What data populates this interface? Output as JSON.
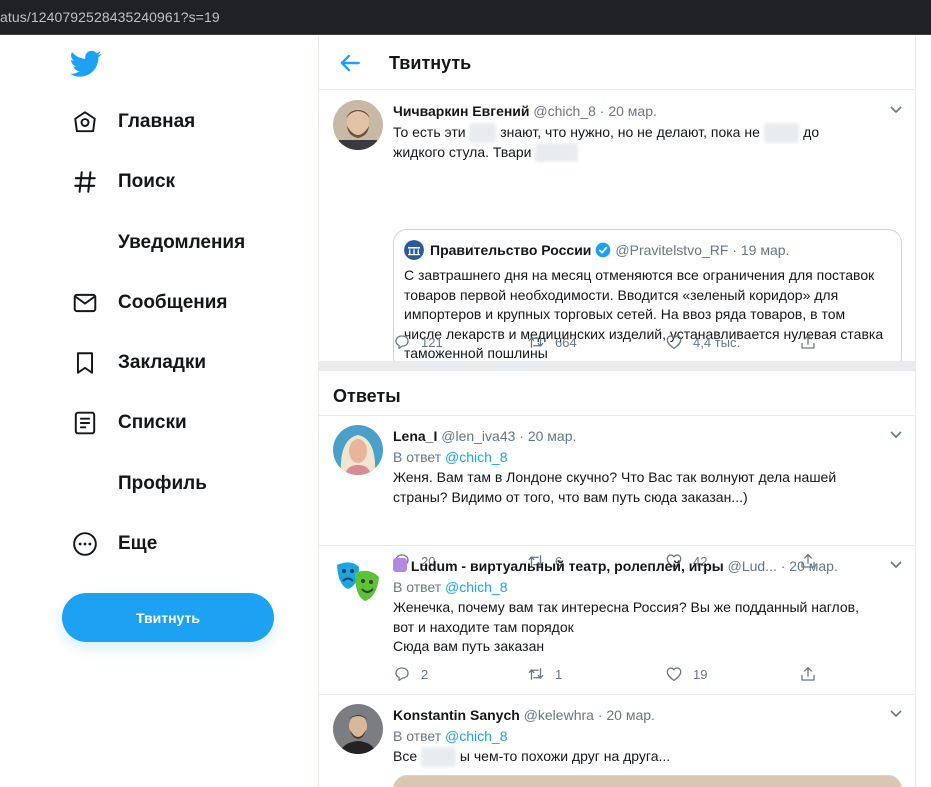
{
  "browser": {
    "url": "atus/1240792528435240961?s=19"
  },
  "sidebar": {
    "items": [
      {
        "label": "Главная"
      },
      {
        "label": "Поиск"
      },
      {
        "label": "Уведомления"
      },
      {
        "label": "Сообщения"
      },
      {
        "label": "Закладки"
      },
      {
        "label": "Списки"
      },
      {
        "label": "Профиль"
      },
      {
        "label": "Еще"
      }
    ],
    "tweet_button": "Твитнуть"
  },
  "header": {
    "title": "Твитнуть"
  },
  "main_tweet": {
    "name": "Чичваркин Евгений",
    "handle": "@chich_8",
    "date": "· 20 мар.",
    "text_a": "То есть эти",
    "text_b": "знают, что нужно, но не делают, пока не",
    "text_c": "до",
    "text_d": "жидкого стула. Твари",
    "quote": {
      "name": "Правительство России",
      "handle": "@Pravitelstvo_RF",
      "date": "· 19 мар.",
      "text": "С завтрашнего дня на месяц отменяются все ограничения для поставок товаров первой необходимости. Вводится «зеленый коридор» для импортеров и крупных торговых сетей. На ввоз ряда товаров, в том числе лекарств и медицинских изделий, устанавливается нулевая ставка таможенной пошлины"
    },
    "replies": "121",
    "retweets": "664",
    "likes": "4,4 тыс."
  },
  "replies_section": {
    "title": "Ответы"
  },
  "replies": [
    {
      "name": "Lena_I",
      "handle": "@len_iva43",
      "date": "· 20 мар.",
      "reply_prefix": "В ответ",
      "reply_to": "@chich_8",
      "text": "Женя. Вам там в Лондоне скучно? Что Вас так волнуют дела нашей страны? Видимо от того, что вам путь сюда заказан...)",
      "replies": "20",
      "retweets": "6",
      "likes": "42"
    },
    {
      "name": "Ludum - виртуальный театр, ролеплей, игры",
      "handle": "@Lud...",
      "date": "· 20 мар.",
      "reply_prefix": "В ответ",
      "reply_to": "@chich_8",
      "text_line1": "Женечка, почему вам так интересна Россия? Вы же подданный наглов,",
      "text_line2": "вот и находите там порядок",
      "text_line3": "Сюда вам путь заказан",
      "replies": "2",
      "retweets": "1",
      "likes": "19"
    },
    {
      "name": "Konstantin Sanych",
      "handle": "@kelewhra",
      "date": "· 20 мар.",
      "reply_prefix": "В ответ",
      "reply_to": "@chich_8",
      "text_a": "Все",
      "text_b": "ы чем-то похожи друг на друга..."
    }
  ],
  "colors": {
    "accent": "#1da1f2",
    "text": "#14171a",
    "muted": "#657786",
    "border": "#e6ecf0"
  }
}
